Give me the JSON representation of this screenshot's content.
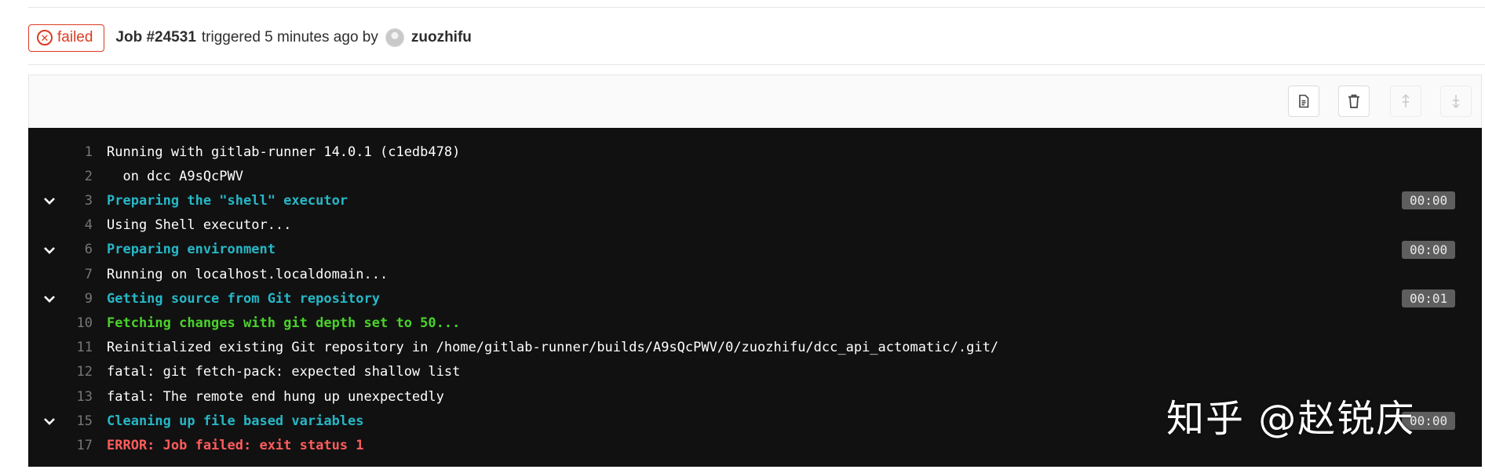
{
  "header": {
    "status_label": "failed",
    "status_icon": "x-circle-icon",
    "job_id": "Job #24531",
    "triggered_text": "triggered 5 minutes ago by",
    "username": "zuozhifu"
  },
  "toolbar": {
    "buttons": [
      {
        "name": "show-raw-button",
        "icon": "document-icon",
        "enabled": true
      },
      {
        "name": "erase-button",
        "icon": "trash-icon",
        "enabled": true
      },
      {
        "name": "scroll-top-button",
        "icon": "scroll-up-icon",
        "enabled": false
      },
      {
        "name": "scroll-bottom-button",
        "icon": "scroll-down-icon",
        "enabled": false
      }
    ]
  },
  "log": {
    "lines": [
      {
        "num": "1",
        "text": "Running with gitlab-runner 14.0.1 (c1edb478)",
        "style": "normal",
        "collapsible": false,
        "duration": ""
      },
      {
        "num": "2",
        "text": "  on dcc A9sQcPWV",
        "style": "normal",
        "collapsible": false,
        "duration": ""
      },
      {
        "num": "3",
        "text": "Preparing the \"shell\" executor",
        "style": "section",
        "collapsible": true,
        "duration": "00:00"
      },
      {
        "num": "4",
        "text": "Using Shell executor...",
        "style": "normal",
        "collapsible": false,
        "duration": ""
      },
      {
        "num": "6",
        "text": "Preparing environment",
        "style": "section",
        "collapsible": true,
        "duration": "00:00"
      },
      {
        "num": "7",
        "text": "Running on localhost.localdomain...",
        "style": "normal",
        "collapsible": false,
        "duration": ""
      },
      {
        "num": "9",
        "text": "Getting source from Git repository",
        "style": "section",
        "collapsible": true,
        "duration": "00:01"
      },
      {
        "num": "10",
        "text": "Fetching changes with git depth set to 50...",
        "style": "green",
        "collapsible": false,
        "duration": ""
      },
      {
        "num": "11",
        "text": "Reinitialized existing Git repository in /home/gitlab-runner/builds/A9sQcPWV/0/zuozhifu/dcc_api_actomatic/.git/",
        "style": "normal",
        "collapsible": false,
        "duration": ""
      },
      {
        "num": "12",
        "text": "fatal: git fetch-pack: expected shallow list",
        "style": "normal",
        "collapsible": false,
        "duration": ""
      },
      {
        "num": "13",
        "text": "fatal: The remote end hung up unexpectedly",
        "style": "normal",
        "collapsible": false,
        "duration": ""
      },
      {
        "num": "15",
        "text": "Cleaning up file based variables",
        "style": "section",
        "collapsible": true,
        "duration": "00:00"
      },
      {
        "num": "17",
        "text": "ERROR: Job failed: exit status 1",
        "style": "red",
        "collapsible": false,
        "duration": ""
      }
    ]
  },
  "watermark": "知乎 @赵锐庆",
  "colors": {
    "failed": "#db3b21",
    "section": "#26b7c7",
    "success_text": "#4ad22c",
    "error_text": "#ff5c5c",
    "log_background": "#111111"
  }
}
